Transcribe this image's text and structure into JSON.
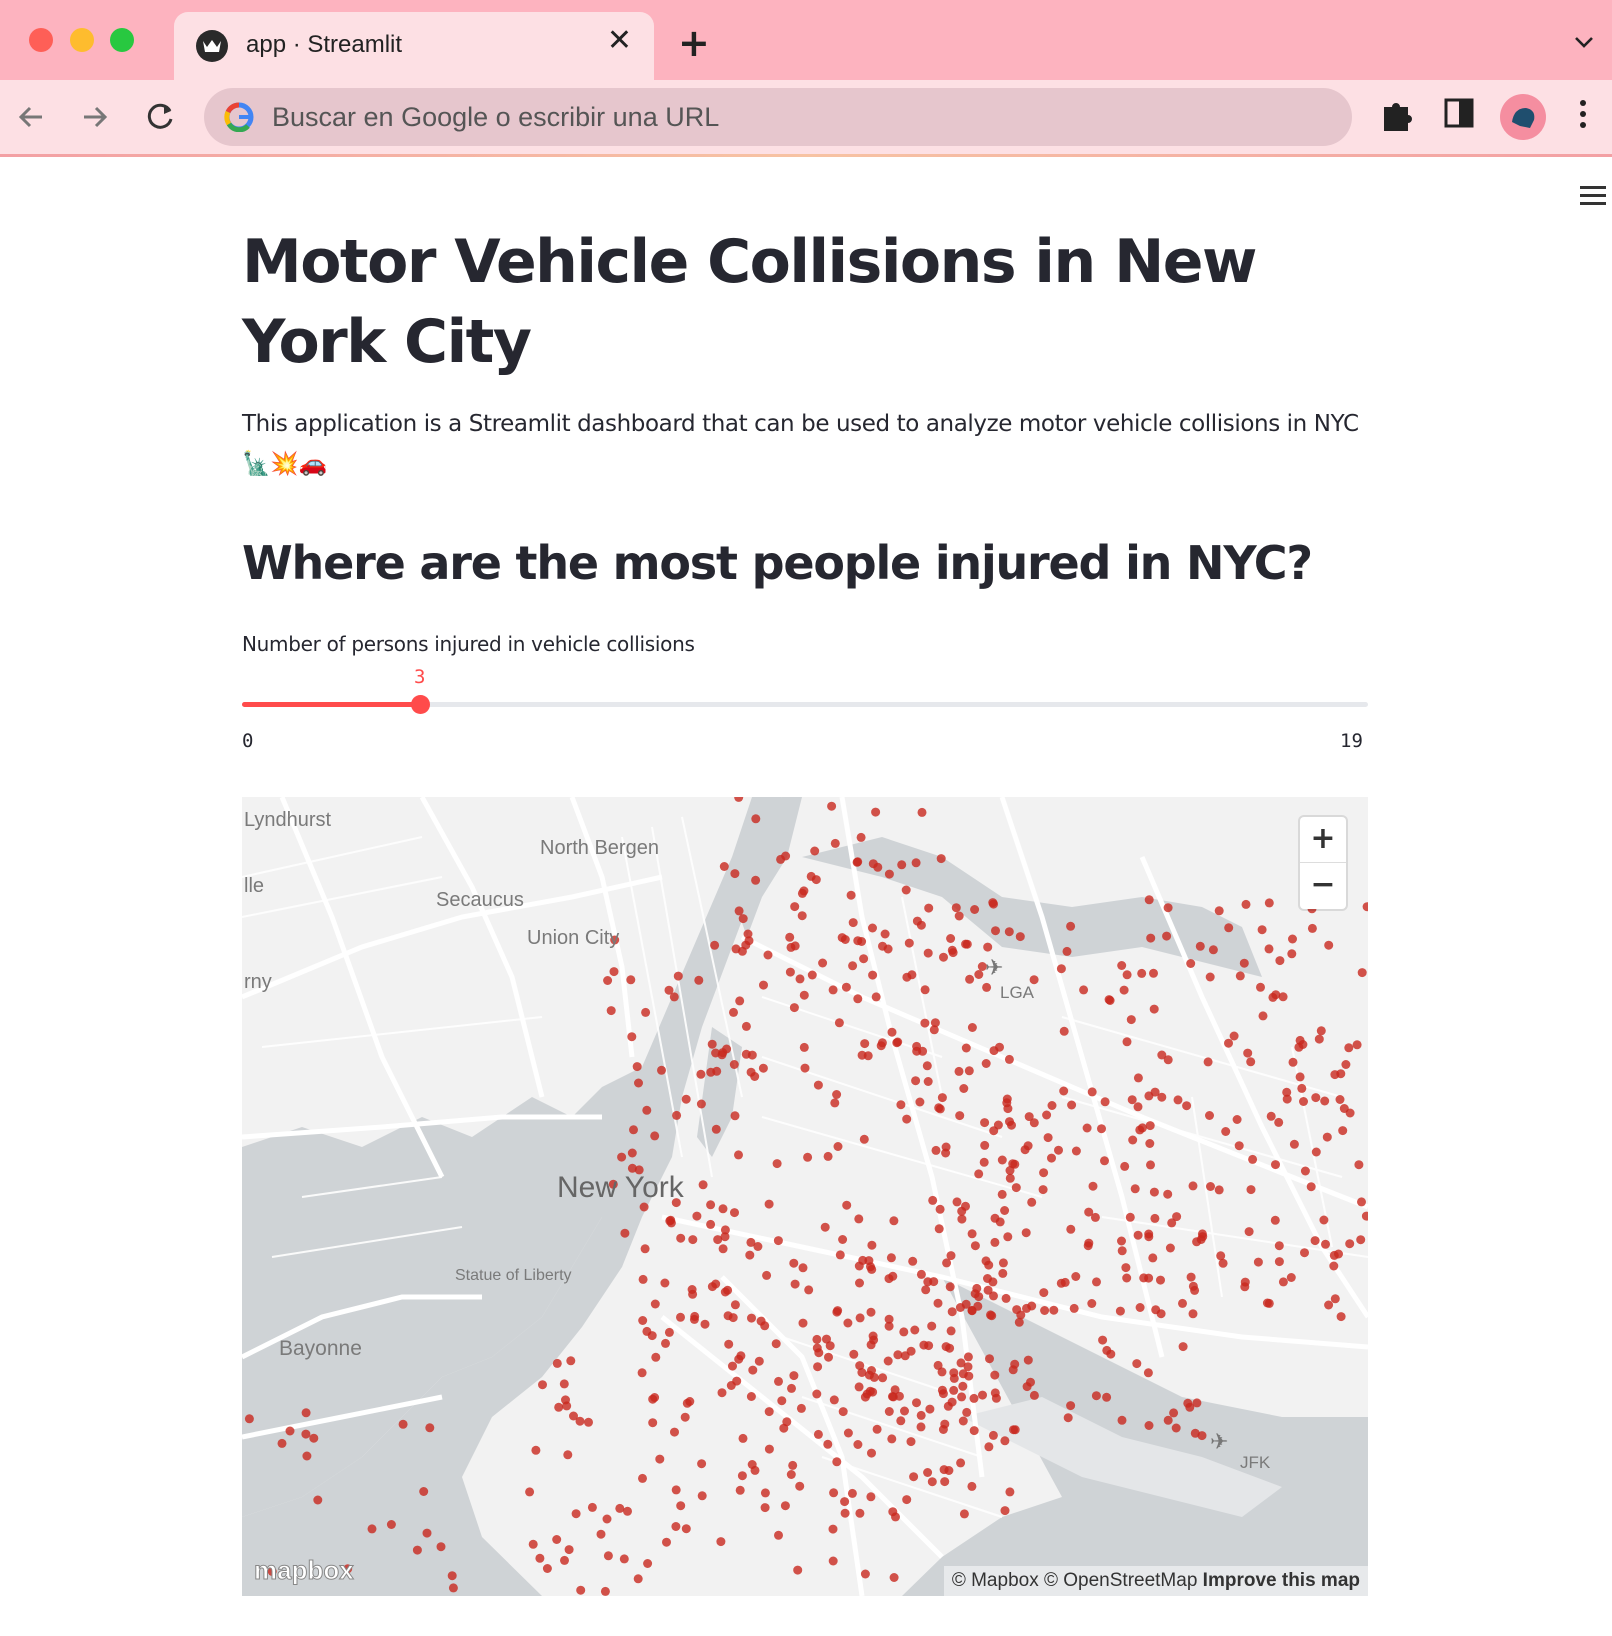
{
  "browser": {
    "tab_title": "app · Streamlit",
    "omnibox_placeholder": "Buscar en Google o escribir una URL"
  },
  "page": {
    "title": "Motor Vehicle Collisions in New York City",
    "description": "This application is a Streamlit dashboard that can be used to analyze motor vehicle collisions in NYC 🗽💥🚗",
    "section_heading": "Where are the most people injured in NYC?",
    "slider": {
      "label": "Number of persons injured in vehicle collisions",
      "value": 3,
      "min": 0,
      "max": 19,
      "value_text": "3",
      "min_text": "0",
      "max_text": "19"
    }
  },
  "map": {
    "place_labels": {
      "lyndhurst": "Lyndhurst",
      "north_bergen": "North Bergen",
      "lle": "lle",
      "secaucus": "Secaucus",
      "union_city": "Union City",
      "rny": "rny",
      "lga": "LGA",
      "new_york": "New York",
      "statue_of_liberty": "Statue of Liberty",
      "bayonne": "Bayonne",
      "jfk": "JFK"
    },
    "zoom_in": "+",
    "zoom_out": "−",
    "attribution": "© Mapbox © OpenStreetMap",
    "improve": "Improve this map",
    "logo": "mapbox",
    "point_color": "#c8281e"
  },
  "colors": {
    "accent": "#ff4b4b",
    "text": "#262730",
    "tabstrip": "#fdb3bf",
    "toolbar": "#fde0e4"
  },
  "icons": {
    "back": "arrow-left-icon",
    "forward": "arrow-right-icon",
    "reload": "reload-icon",
    "extensions": "puzzle-icon",
    "side_panel": "side-panel-icon",
    "menu": "kebab-menu-icon",
    "app_menu": "hamburger-icon"
  }
}
